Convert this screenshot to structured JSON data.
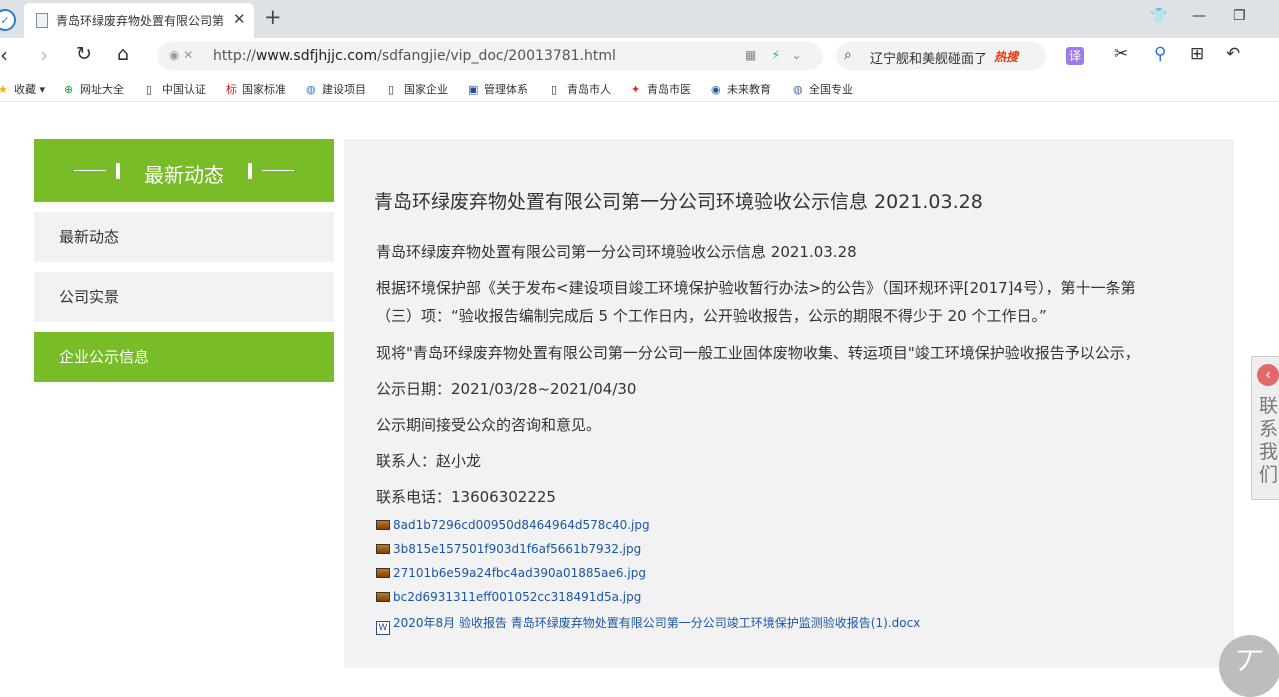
{
  "browser": {
    "tab_title": "青岛环绿废弃物处置有限公司第",
    "tab_close": "✕",
    "new_tab": "+",
    "url_prefix": "http://",
    "url_domain": "www.sdfjhjjc.com",
    "url_path": "/sdfangjie/vip_doc/20013781.html",
    "search_text": "辽宁舰和美舰碰面了",
    "search_hot": "热搜",
    "translate_label": "译"
  },
  "bookmarks": [
    {
      "label": "收藏",
      "icon": "star-icon"
    },
    {
      "label": "网址大全",
      "icon": "plus-circle-icon"
    },
    {
      "label": "中国认证",
      "icon": "page-icon"
    },
    {
      "label": "国家标准",
      "icon": "biao-icon"
    },
    {
      "label": "建设项目",
      "icon": "globe-icon"
    },
    {
      "label": "国家企业",
      "icon": "page-icon"
    },
    {
      "label": "管理体系",
      "icon": "blue-square-icon"
    },
    {
      "label": "青岛市人",
      "icon": "page-icon"
    },
    {
      "label": "青岛市医",
      "icon": "red-emblem-icon"
    },
    {
      "label": "未来教育",
      "icon": "emblem-icon"
    },
    {
      "label": "全国专业",
      "icon": "globe-icon"
    }
  ],
  "sidebar": {
    "header": "最新动态",
    "items": [
      {
        "label": "最新动态",
        "active": false
      },
      {
        "label": "公司实景",
        "active": false
      },
      {
        "label": "企业公示信息",
        "active": true
      }
    ]
  },
  "article": {
    "title": "青岛环绿废弃物处置有限公司第一分公司环境验收公示信息 2021.03.28",
    "lines": [
      "青岛环绿废弃物处置有限公司第一分公司环境验收公示信息 2021.03.28",
      "根据环境保护部《关于发布<建设项目竣工环境保护验收暂行办法>的公告》（国环规环评[2017]4号），第十一条第",
      "（三）项：“验收报告编制完成后 5 个工作日内，公开验收报告，公示的期限不得少于 20 个工作日。”",
      "现将\"青岛环绿废弃物处置有限公司第一分公司一般工业固体废物收集、转运项目\"竣工环境保护验收报告予以公示，",
      "公示日期：2021/03/28~2021/04/30",
      "公示期间接受公众的咨询和意见。",
      "联系人：赵小龙",
      "联系电话：13606302225"
    ],
    "attachments": [
      {
        "name": "8ad1b7296cd00950d8464964d578c40.jpg",
        "type": "image"
      },
      {
        "name": "3b815e157501f903d1f6af5661b7932.jpg",
        "type": "image"
      },
      {
        "name": "27101b6e59a24fbc4ad390a01885ae6.jpg",
        "type": "image"
      },
      {
        "name": "bc2d6931311eff001052cc318491d5a.jpg",
        "type": "image"
      },
      {
        "name": "2020年8月 验收报告 青岛环绿废弃物处置有限公司第一分公司竣工环境保护监测验收报告(1).docx",
        "type": "doc"
      }
    ]
  },
  "contact_tab": {
    "label": "联系我们"
  },
  "back_to_top": {
    "label": "丆"
  }
}
